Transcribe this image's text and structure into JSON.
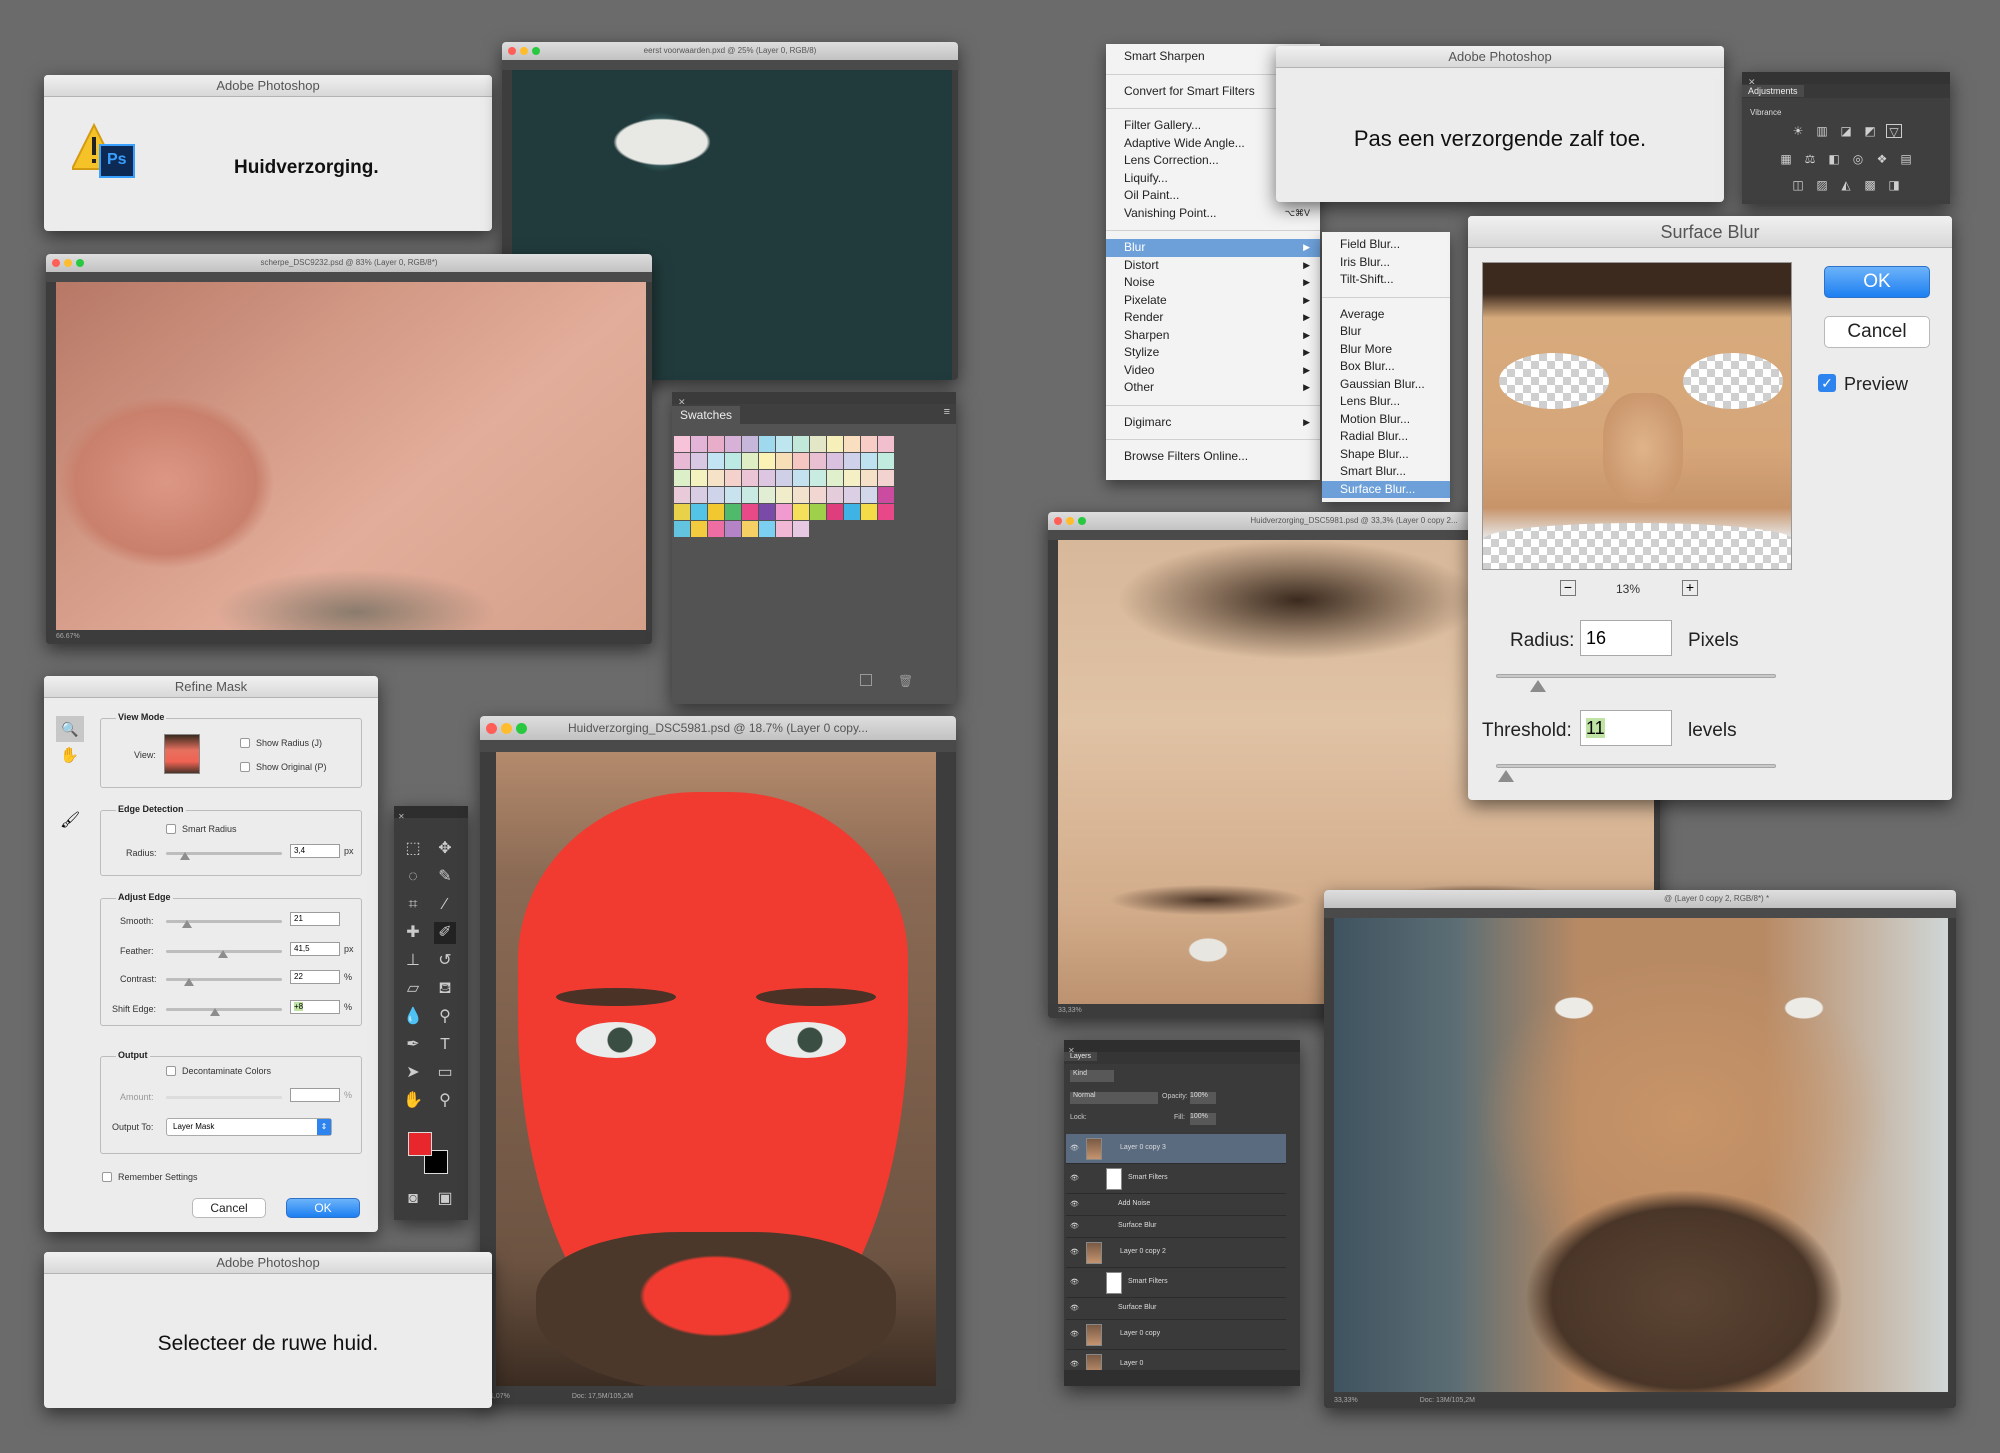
{
  "dialog_huid": {
    "title": "Adobe Photoshop",
    "message": "Huidverzorging.",
    "ps_badge": "Ps"
  },
  "dialog_zalf": {
    "title": "Adobe Photoshop",
    "message": "Pas een verzorgende zalf toe."
  },
  "dialog_select": {
    "title": "Adobe Photoshop",
    "message": "Selecteer de ruwe huid."
  },
  "filter_menu": {
    "items": [
      "Smart Sharpen",
      "Convert for Smart Filters",
      "Filter Gallery...",
      "Adaptive Wide Angle...",
      "Lens Correction...",
      "Liquify...",
      "Oil Paint...",
      "Vanishing Point...",
      "Blur",
      "Distort",
      "Noise",
      "Pixelate",
      "Render",
      "Sharpen",
      "Stylize",
      "Video",
      "Other",
      "Digimarc",
      "Browse Filters Online..."
    ],
    "vanishing_shortcut": "⌥⌘V"
  },
  "blur_submenu": {
    "items": [
      "Field Blur...",
      "Iris Blur...",
      "Tilt-Shift...",
      "Average",
      "Blur",
      "Blur More",
      "Box Blur...",
      "Gaussian Blur...",
      "Lens Blur...",
      "Motion Blur...",
      "Radial Blur...",
      "Shape Blur...",
      "Smart Blur...",
      "Surface Blur..."
    ]
  },
  "surface_blur": {
    "title": "Surface Blur",
    "ok": "OK",
    "cancel": "Cancel",
    "preview": "Preview",
    "zoom": "13%",
    "radius_label": "Radius:",
    "radius_value": "16",
    "radius_unit": "Pixels",
    "threshold_label": "Threshold:",
    "threshold_value": "11",
    "threshold_unit": "levels"
  },
  "adjustments": {
    "tab": "Adjustments",
    "label": "Vibrance"
  },
  "swatches": {
    "tab": "Swatches",
    "colors": [
      "#f6c3d8",
      "#e4b4d8",
      "#e8aec9",
      "#d8b1d9",
      "#c6b6d9",
      "#9fd9ee",
      "#bde6ef",
      "#c2e8d9",
      "#e3e7c8",
      "#f6efba",
      "#f9dfc0",
      "#f8cdc6",
      "#f1bfcd",
      "#e7b9d4",
      "#d9c8e4",
      "#c3e4f3",
      "#bde9e4",
      "#dfeec5",
      "#fbf2b6",
      "#f6deb6",
      "#f6c6c2",
      "#e9bfd2",
      "#dac1e0",
      "#cfd0ea",
      "#bfe2f0",
      "#c2ebe0",
      "#dbefc9",
      "#f4f2bf",
      "#f6e2c6",
      "#f5d1cc",
      "#ebc5d6",
      "#ddc6e2",
      "#cfcfe8",
      "#c3e1ef",
      "#c8ebe2",
      "#e0f0cd",
      "#f4efc5",
      "#f4e1c8",
      "#f2d3cf",
      "#e9cad8",
      "#d9cde3",
      "#d0d4ea",
      "#c9e3ee",
      "#c9e9e3",
      "#e1eed3",
      "#f1edca",
      "#f2e1cc",
      "#f1d6d2",
      "#e5ccda",
      "#dbcfe5",
      "#d2d7ea",
      "#ca4ba0",
      "#e8d24a",
      "#53c4e6",
      "#f2c830",
      "#4fba6b",
      "#e84a88",
      "#7a4aa8",
      "#f09ad0",
      "#f4e05a",
      "#9ed04a",
      "#de3e7c",
      "#3fb4e4",
      "#f4dc48",
      "#e84888",
      "#62c4de",
      "#f2cc3e",
      "#ee6ea4",
      "#b484c6",
      "#f6d064",
      "#7ccff0",
      "#f0b8d4",
      "#e6c8e2"
    ]
  },
  "refine_mask": {
    "title": "Refine Mask",
    "view_mode": "View Mode",
    "view": "View:",
    "show_radius": "Show Radius (J)",
    "show_original": "Show Original (P)",
    "edge_detection": "Edge Detection",
    "smart_radius": "Smart Radius",
    "radius": "Radius:",
    "radius_value": "3,4",
    "radius_unit": "px",
    "adjust_edge": "Adjust Edge",
    "smooth": "Smooth:",
    "smooth_value": "21",
    "feather": "Feather:",
    "feather_value": "41,5",
    "feather_unit": "px",
    "contrast": "Contrast:",
    "contrast_value": "22",
    "contrast_unit": "%",
    "shift": "Shift Edge:",
    "shift_value": "+8",
    "shift_unit": "%",
    "output": "Output",
    "decontaminate": "Decontaminate Colors",
    "amount": "Amount:",
    "amount_unit": "%",
    "output_to": "Output To:",
    "output_to_value": "Layer Mask",
    "remember": "Remember Settings",
    "cancel": "Cancel",
    "ok": "OK"
  },
  "doc_eye": {
    "title": "eerst voorwaarden.pxd @ 25% (Layer 0, RGB/8)"
  },
  "doc_nose": {
    "title": "scherpe_DSC9232.psd @ 83% (Layer 0, RGB/8*)",
    "status": "66.67%"
  },
  "doc_red": {
    "title": "Huidverzorging_DSC5981.psd @ 18.7% (Layer 0 copy...",
    "status": "1,07%",
    "status2": "Doc: 17,5M/105,2M"
  },
  "doc_fore": {
    "title": "Huidverzorging_DSC5981.psd @ 33,3% (Layer 0 copy 2...",
    "status": "33,33%"
  },
  "doc_beard": {
    "title": "@ (Layer 0 copy 2, RGB/8*) *",
    "status": "33,33%",
    "status2": "Doc: 13M/105,2M"
  },
  "layers": {
    "tab": "Layers",
    "kind": "Kind",
    "blend": "Normal",
    "opacity_label": "Opacity:",
    "opacity_value": "100%",
    "lock": "Lock:",
    "fill_label": "Fill:",
    "fill_value": "100%",
    "rows": [
      "Layer 0 copy 3",
      "Smart Filters",
      "Add Noise",
      "Surface Blur",
      "Layer 0 copy 2",
      "Smart Filters",
      "Surface Blur",
      "Layer 0 copy",
      "Layer 0"
    ]
  }
}
